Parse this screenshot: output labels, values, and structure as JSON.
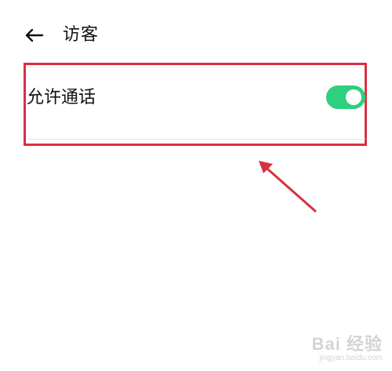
{
  "header": {
    "back_icon": "arrow-left-icon",
    "title": "访客"
  },
  "settings": {
    "allow_call": {
      "label": "允许通话",
      "enabled": true,
      "toggle_color": "#2ecf7f"
    }
  },
  "annotation": {
    "box_color": "#d8303f",
    "arrow_color": "#d8303f"
  },
  "watermark": {
    "logo_text": "Bai 经验",
    "url": "jingyan.baidu.com"
  }
}
